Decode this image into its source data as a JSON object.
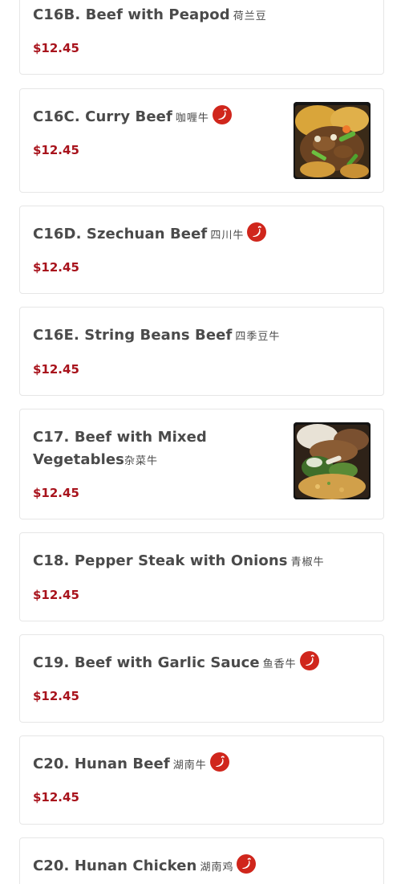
{
  "items": [
    {
      "code_name": "C16B. Beef with Peapod",
      "chinese": "荷兰豆",
      "price": "$12.45",
      "spicy": false,
      "has_photo": false
    },
    {
      "code_name": "C16C. Curry Beef",
      "chinese": "咖喱牛",
      "price": "$12.45",
      "spicy": true,
      "has_photo": true
    },
    {
      "code_name": "C16D. Szechuan Beef",
      "chinese": "四川牛",
      "price": "$12.45",
      "spicy": true,
      "has_photo": false
    },
    {
      "code_name": "C16E. String Beans Beef",
      "chinese": "四季豆牛",
      "price": "$12.45",
      "spicy": false,
      "has_photo": false
    },
    {
      "code_name": "C17. Beef with Mixed Vegetables",
      "chinese": "杂菜牛",
      "price": "$12.45",
      "spicy": false,
      "has_photo": true
    },
    {
      "code_name": "C18. Pepper Steak with Onions",
      "chinese": "青椒牛",
      "price": "$12.45",
      "spicy": false,
      "has_photo": false
    },
    {
      "code_name": "C19. Beef with Garlic Sauce",
      "chinese": "鱼香牛",
      "price": "$12.45",
      "spicy": true,
      "has_photo": false
    },
    {
      "code_name": "C20. Hunan Beef",
      "chinese": "湖南牛",
      "price": "$12.45",
      "spicy": true,
      "has_photo": false
    },
    {
      "code_name": "C20. Hunan Chicken",
      "chinese": "湖南鸡",
      "price": "",
      "spicy": true,
      "has_photo": false
    }
  ],
  "colors": {
    "price": "#a8131c",
    "spicy_badge": "#d0261c",
    "card_border": "#e6e6e6",
    "title_text": "#4a4a4a"
  },
  "icons": {
    "spicy": "chili-pepper-icon",
    "photo": "food-photo"
  }
}
